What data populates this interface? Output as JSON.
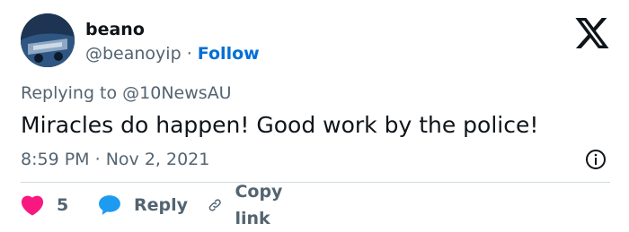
{
  "author": {
    "name": "beano",
    "handle": "@beanoyip",
    "separator": "·",
    "follow_label": "Follow",
    "avatar_icon": "avatar-photo"
  },
  "reply_context": {
    "prefix": "Replying to",
    "mention": "@10NewsAU"
  },
  "tweet": {
    "text": "Miracles do happen! Good work by the police!",
    "time": "8:59 PM",
    "separator": "·",
    "date": "Nov 2, 2021"
  },
  "actions": {
    "like_count": "5",
    "reply_label": "Reply",
    "copy_link_label": "Copy link"
  },
  "colors": {
    "text": "#0f1419",
    "secondary": "#536471",
    "follow": "#006fd6",
    "like": "#f91880",
    "reply_bubble": "#1d9bf0",
    "divider": "#cfd9de"
  },
  "icons": [
    "x-logo-icon",
    "info-icon",
    "heart-icon",
    "reply-bubble-icon",
    "link-icon"
  ]
}
